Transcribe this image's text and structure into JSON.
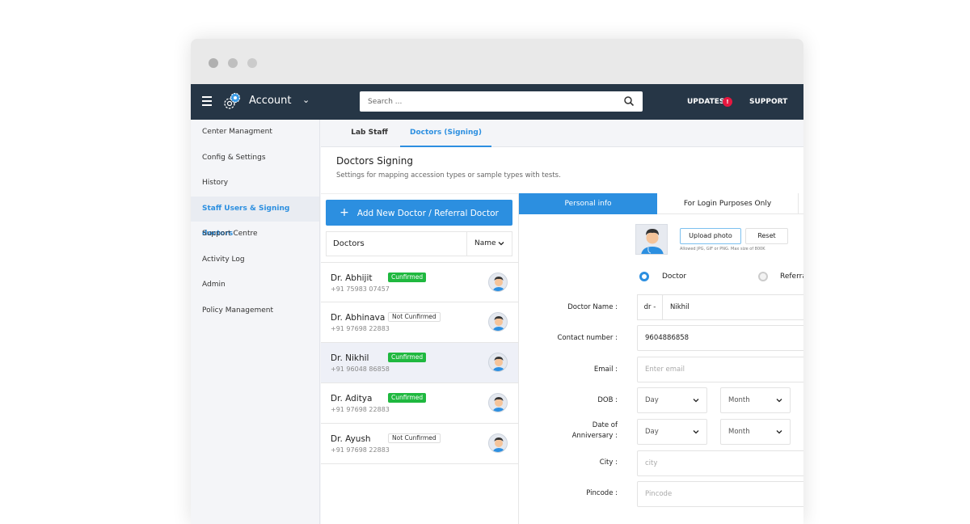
{
  "header": {
    "title": "Account",
    "search_placeholder": "Search ...",
    "updates_label": "UPDATES",
    "updates_badge": "!",
    "support_label": "SUPPORT"
  },
  "sidebar": {
    "items": [
      {
        "label": "Center Managment"
      },
      {
        "label": "Config & Settings"
      },
      {
        "label": "History"
      },
      {
        "label": "Staff Users & Signing doctors",
        "active": true
      },
      {
        "label": "Support Centre"
      },
      {
        "label": "Activity Log"
      },
      {
        "label": "Admin"
      },
      {
        "label": "Policy Management"
      }
    ]
  },
  "tabs": [
    {
      "label": "Lab Staff"
    },
    {
      "label": "Doctors (Signing)",
      "active": true
    }
  ],
  "page": {
    "title": "Doctors Signing",
    "subtitle": "Settings for mapping accession types or sample types with tests."
  },
  "doctors_panel": {
    "add_button": "Add New Doctor / Referral Doctor",
    "add_icon": "+",
    "list_label": "Doctors",
    "sort_label": "Name",
    "items": [
      {
        "name": "Dr. Abhijit",
        "phone": "+91 75983 07457",
        "status": "Cunfirmed",
        "confirmed": true
      },
      {
        "name": "Dr. Abhinava",
        "phone": "+91 97698 22883",
        "status": "Not Cunfirmed",
        "confirmed": false
      },
      {
        "name": "Dr. Nikhil",
        "phone": "+91 96048 86858",
        "status": "Cunfirmed",
        "confirmed": true,
        "selected": true
      },
      {
        "name": "Dr. Aditya",
        "phone": "+91 97698 22883",
        "status": "Cunfirmed",
        "confirmed": true
      },
      {
        "name": "Dr. Ayush",
        "phone": "+91 97698 22883",
        "status": "Not Cunfirmed",
        "confirmed": false
      }
    ]
  },
  "form": {
    "tabs": [
      {
        "label": "Personal info",
        "active": true
      },
      {
        "label": "For Login Purposes Only"
      }
    ],
    "upload_label": "Upload photo",
    "reset_label": "Reset",
    "upload_hint": "Allowed JPG, GIF or PNG. Max size of 800K",
    "radio_options": [
      {
        "label": "Doctor",
        "checked": true
      },
      {
        "label": "Referral",
        "checked": false
      }
    ],
    "doctor_name_label": "Doctor Name :",
    "doctor_name_prefix": "dr -",
    "doctor_name_value": "Nikhil",
    "contact_label": "Contact number :",
    "contact_value": "9604886858",
    "email_label": "Email :",
    "email_placeholder": "Enter email",
    "dob_label": "DOB :",
    "anniversary_label_1": "Date of",
    "anniversary_label_2": "Anniversary :",
    "day_placeholder": "Day",
    "month_placeholder": "Month",
    "city_label": "City :",
    "city_placeholder": "city",
    "pincode_label": "Pincode :",
    "pincode_placeholder": "Pincode"
  },
  "colors": {
    "topbar": "#263646",
    "accent": "#2c8fe0",
    "confirmed": "#1fb83f",
    "badge": "#e6173f"
  }
}
